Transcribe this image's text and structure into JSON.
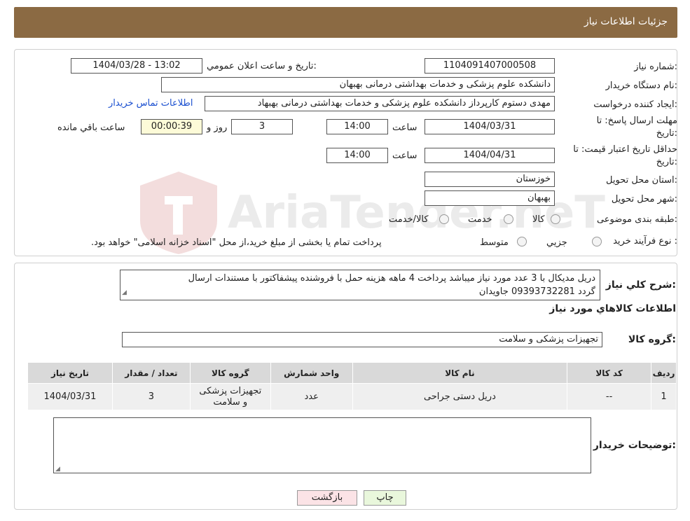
{
  "header": {
    "title": "جزئیات اطلاعات نیاز"
  },
  "fields": {
    "need_number_label": "شماره نیاز:",
    "need_number": "1104091407000508",
    "announce_label": "تاریخ و ساعت اعلان عمومي:",
    "announce_value": "1404/03/28 - 13:02",
    "buyer_org_label": "نام دستگاه خريدار:",
    "buyer_org": "دانشکده علوم پزشکی و خدمات بهداشتی  درمانی بهبهان",
    "creator_label": "ايجاد کننده درخواست:",
    "creator": "مهدی دستوم کارپرداز دانشکده علوم پزشکی و خدمات بهداشتی  درمانی بهبهاد",
    "contact_link": "اطلاعات تماس خريدار",
    "deadline_label_1": "مهلت ارسال پاسخ: تا",
    "deadline_label_2": "تاريخ:",
    "deadline_date": "1404/03/31",
    "time_label": "ساعت",
    "deadline_time": "14:00",
    "days_value": "3",
    "days_label": "روز و",
    "remaining_value": "00:00:39",
    "remaining_label": "ساعت باقي مانده",
    "validity_label_1": "حداقل تاريخ اعتبار قيمت: تا",
    "validity_label_2": "تاريخ:",
    "validity_date": "1404/04/31",
    "validity_time": "14:00",
    "province_label": "استان محل تحويل:",
    "province": "خوزستان",
    "city_label": "شهر محل تحويل:",
    "city": "بهبهان",
    "category_label": "طبقه بندی موضوعی:",
    "category_options": [
      "کالا",
      "خدمت",
      "کالا/خدمت"
    ],
    "process_label": "نوع فرآيند خريد :",
    "process_options": [
      "جزيي",
      "متوسط"
    ],
    "process_note": "پرداخت تمام يا بخشی از مبلغ خريد،از محل \"اسناد خزانه اسلامی\" خواهد بود."
  },
  "description": {
    "label": "شرح کلي نياز:",
    "line1": "دریل مدیکال با 3 عدد مورد نیاز میباشد پرداخت 4 ماهه هزینه حمل با فروشنده پیشفاکتور با مستندات ارسال",
    "line2": "گردد 09393732281 جاویدان"
  },
  "items_title": "اطلاعات کالاهاي مورد نياز",
  "group_label": "گروه کالا:",
  "group_value": "تجهیزات پزشکی و سلامت",
  "table": {
    "headers": [
      "رديف",
      "کد کالا",
      "نام کالا",
      "واحد شمارش",
      "گروه کالا",
      "تعداد / مقدار",
      "تاريخ نياز"
    ],
    "rows": [
      [
        "1",
        "--",
        "دریل دستی جراحی",
        "عدد",
        "تجهیزات پزشکی و سلامت",
        "3",
        "1404/03/31"
      ]
    ]
  },
  "buyer_notes_label": "توضيحات خريدار:",
  "buttons": {
    "print": "چاپ",
    "back": "بازگشت"
  },
  "watermark_text": "AriaTender.neT",
  "colors": {
    "header": "#8b6a43",
    "print_bg": "#e9f7dc",
    "back_bg": "#fbe3e6",
    "link": "#1a4fd0"
  }
}
